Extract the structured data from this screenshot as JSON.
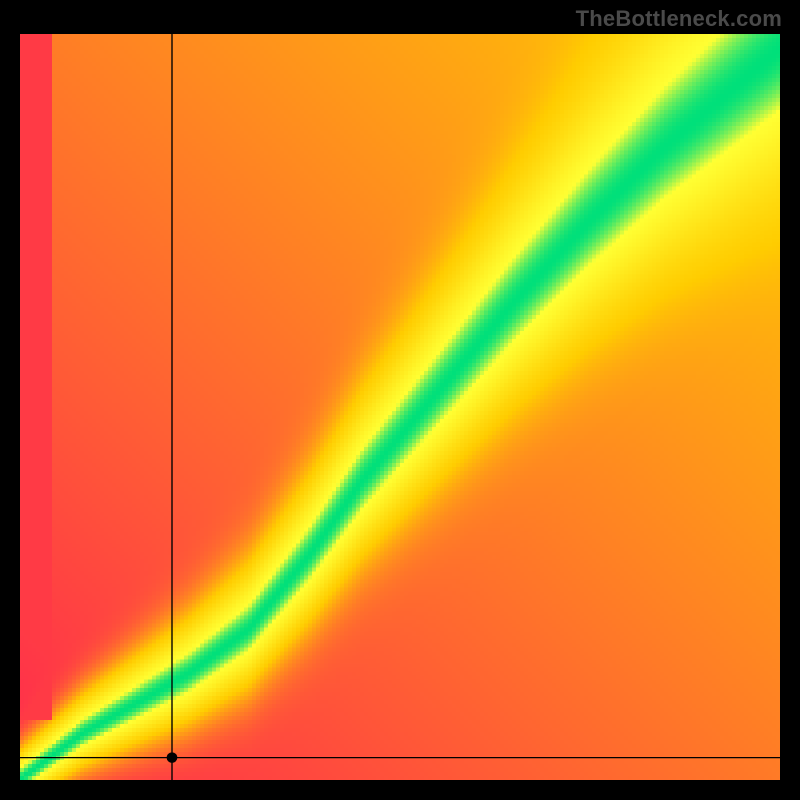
{
  "watermark": "TheBottleneck.com",
  "chart_data": {
    "type": "heatmap",
    "title": "",
    "xlabel": "",
    "ylabel": "",
    "xlim": [
      0,
      100
    ],
    "ylim": [
      0,
      100
    ],
    "marker": {
      "x": 20,
      "y": 3
    },
    "crosshair": {
      "x": 20,
      "y": 3
    },
    "ridge_path": [
      {
        "x": 0,
        "y": 0
      },
      {
        "x": 8,
        "y": 6
      },
      {
        "x": 15,
        "y": 10
      },
      {
        "x": 22,
        "y": 14
      },
      {
        "x": 30,
        "y": 20
      },
      {
        "x": 38,
        "y": 30
      },
      {
        "x": 45,
        "y": 40
      },
      {
        "x": 55,
        "y": 52
      },
      {
        "x": 65,
        "y": 64
      },
      {
        "x": 75,
        "y": 75
      },
      {
        "x": 85,
        "y": 85
      },
      {
        "x": 100,
        "y": 98
      }
    ],
    "color_stops": [
      {
        "value": 0.0,
        "color": "#ff2a4d"
      },
      {
        "value": 0.5,
        "color": "#ffcc00"
      },
      {
        "value": 0.9,
        "color": "#ffff33"
      },
      {
        "value": 1.0,
        "color": "#00e07a"
      }
    ],
    "grid": false,
    "legend": false
  }
}
